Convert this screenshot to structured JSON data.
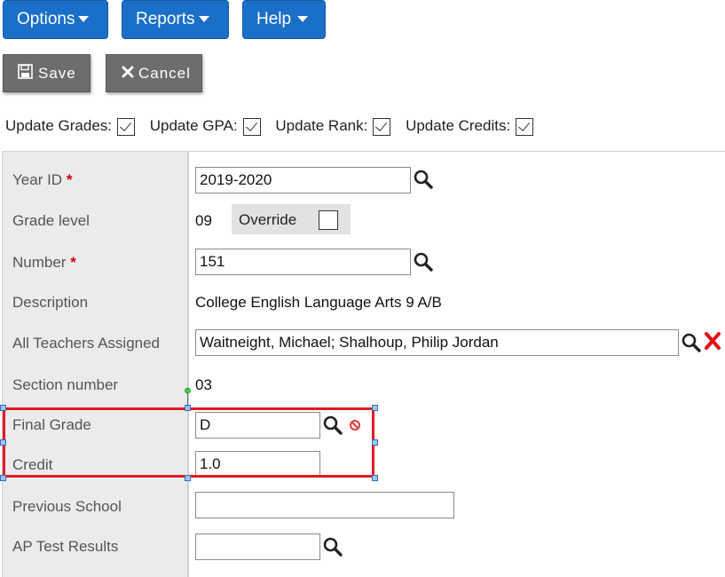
{
  "menu": {
    "options": "Options",
    "reports": "Reports",
    "help": "Help"
  },
  "toolbar": {
    "save": "Save",
    "cancel": "Cancel"
  },
  "update_row": {
    "grades": {
      "label": "Update Grades:",
      "checked": true
    },
    "gpa": {
      "label": "Update GPA:",
      "checked": true
    },
    "rank": {
      "label": "Update Rank:",
      "checked": true
    },
    "credits": {
      "label": "Update Credits:",
      "checked": true
    }
  },
  "form": {
    "year_id": {
      "label": "Year ID",
      "required": "*",
      "value": "2019-2020"
    },
    "grade_level": {
      "label": "Grade level",
      "value": "09",
      "override_label": "Override",
      "override_checked": false
    },
    "number": {
      "label": "Number",
      "required": "*",
      "value": "151"
    },
    "description": {
      "label": "Description",
      "value": "College English Language Arts 9 A/B"
    },
    "teachers": {
      "label": "All Teachers Assigned",
      "value": "Waitneight, Michael; Shalhoup, Philip Jordan"
    },
    "section_number": {
      "label": "Section number",
      "value": "03"
    },
    "final_grade": {
      "label": "Final Grade",
      "value": "D"
    },
    "credit": {
      "label": "Credit",
      "value": "1.0"
    },
    "previous_school": {
      "label": "Previous School",
      "value": ""
    },
    "ap_test_results": {
      "label": "AP Test Results",
      "value": ""
    }
  },
  "colors": {
    "menu_blue": "#1a6fc9",
    "toolbar_gray": "#6d6d6d",
    "required_red": "#cc0000",
    "highlight_red": "#e01b24"
  }
}
